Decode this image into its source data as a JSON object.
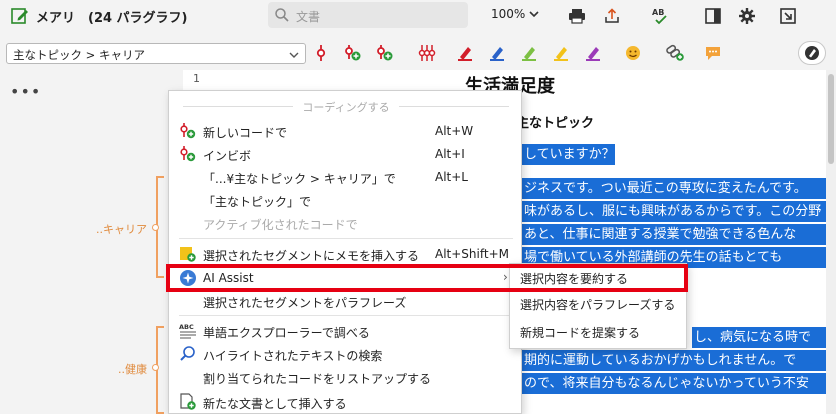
{
  "app": {
    "title": "メアリ　(24 パラグラフ)",
    "search_placeholder": "文書",
    "zoom": "100%"
  },
  "toolbar2": {
    "code_select_value": "主なトピック > キャリア"
  },
  "left_panel": {
    "more": "•••",
    "bracket1_label": "..キャリア",
    "bracket2_label": "..健康"
  },
  "document": {
    "line_number": "1",
    "title": "生活満足度",
    "subtitle": "– 主なトピック",
    "lines": [
      "していますか？",
      "ジネスです。つい最近この専攻に変えたんです。",
      "味があるし、服にも興味があるからです。この分野",
      "あと、仕事に関連する授業で勉強できる色んな",
      "場で働いている外部講師の先生の話もとても",
      "し、病気になる時で",
      "期的に運動しているおかげかもしれません。で",
      "ので、将来自分もなるんじゃないかっていう不安"
    ]
  },
  "context_menu": {
    "header": "コーディングする",
    "items": [
      {
        "label": "新しいコードで",
        "shortcut": "Alt+W"
      },
      {
        "label": "インビボ",
        "shortcut": "Alt+I"
      },
      {
        "label": "「...¥主なトピック > キャリア」で",
        "shortcut": "Alt+L"
      },
      {
        "label": "「主なトピック」で",
        "shortcut": ""
      },
      {
        "label": "アクティブ化されたコードで",
        "shortcut": ""
      },
      {
        "label": "選択されたセグメントにメモを挿入する",
        "shortcut": "Alt+Shift+M"
      },
      {
        "label": "AI Assist",
        "shortcut": ""
      },
      {
        "label": "選択されたセグメントをパラフレーズ",
        "shortcut": ""
      },
      {
        "label": "単語エクスプローラーで調べる",
        "shortcut": ""
      },
      {
        "label": "ハイライトされたテキストの検索",
        "shortcut": ""
      },
      {
        "label": "割り当てられたコードをリストアップする",
        "shortcut": ""
      },
      {
        "label": "新たな文書として挿入する",
        "shortcut": ""
      }
    ]
  },
  "submenu": {
    "items": [
      {
        "label": "選択内容を要約する"
      },
      {
        "label": "選択内容をパラフレーズする"
      },
      {
        "label": "新規コードを提案する"
      }
    ]
  },
  "colors": {
    "selection": "#1a6dd6",
    "highlight_frame": "#e60012",
    "code_bracket": "#f0a060"
  }
}
